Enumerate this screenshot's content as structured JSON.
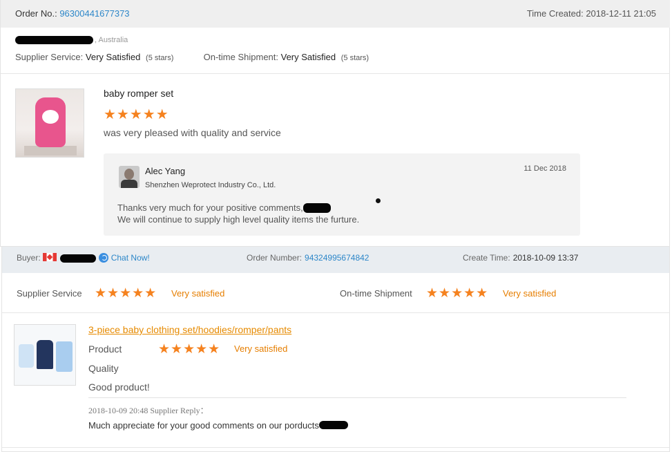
{
  "review1": {
    "order_label": "Order No.:",
    "order_number": "96300441677373",
    "time_created": "Time Created: 2018-12-11 21:05",
    "buyer_location": ", Australia",
    "supplier_service_label": "Supplier Service:",
    "supplier_service_value": "Very Satisfied",
    "supplier_service_stars": "(5 stars)",
    "shipment_label": "On-time Shipment:",
    "shipment_value": "Very Satisfied",
    "shipment_stars": "(5 stars)",
    "product_title": "baby romper set",
    "rating_stars": 5,
    "comment": "was very pleased with quality and service",
    "reply": {
      "name": "Alec Yang",
      "company": "Shenzhen Weprotect Industry Co., Ltd.",
      "date": "11 Dec 2018",
      "line1": "Thanks very much for your positive comments,",
      "line2": "We will continue to supply high level quality items the furture."
    }
  },
  "review2": {
    "buyer_label": "Buyer:",
    "buyer_flag": "canada-flag-icon",
    "chat_label": "Chat Now!",
    "order_number_label": "Order Number:",
    "order_number": "94324995674842",
    "create_time_label": "Create Time:",
    "create_time": "2018-10-09 13:37",
    "supplier_service_label": "Supplier Service",
    "supplier_service_value": "Very satisfied",
    "shipment_label": "On-time Shipment",
    "shipment_value": "Very satisfied",
    "product_title": "3-piece baby clothing set/hoodies/romper/pants",
    "product_label": "Product",
    "product_value": "Very satisfied",
    "quality_label": "Quality",
    "comment": "Good product!",
    "reply_meta": "2018-10-09 20:48  Supplier Reply：",
    "reply_text": "Much appreciate for your good comments on our porducts"
  },
  "colors": {
    "star": "#f5821f",
    "link": "#2d87c9",
    "orange_text": "#e67e00"
  }
}
